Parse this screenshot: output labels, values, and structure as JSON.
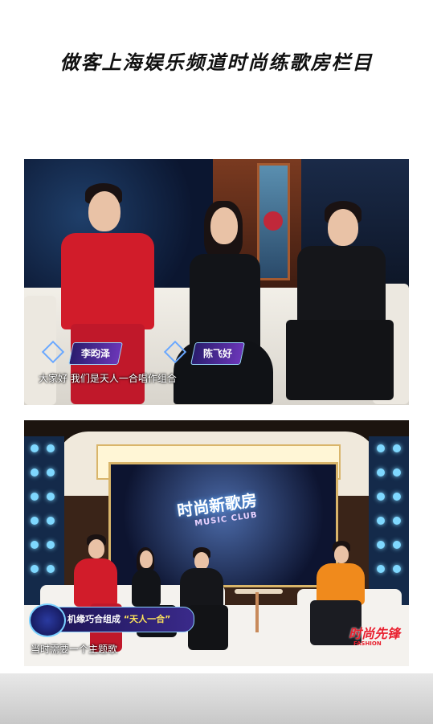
{
  "page": {
    "title": "做客上海娱乐频道时尚练歌房栏目"
  },
  "frame1": {
    "name_tags": [
      "李昀泽",
      "陈飞好"
    ],
    "subtitle": "大家好 我们是天人一合唱作组合"
  },
  "frame2": {
    "logo": "时尚新歌房",
    "logo_sub": "MUSIC CLUB",
    "caption_prefix": "机缘巧合组成",
    "caption_highlight": "“天人一合”",
    "subtitle": "当时需要一个主题歌",
    "brand": "时尚先锋",
    "brand_sub": "FASHION"
  }
}
